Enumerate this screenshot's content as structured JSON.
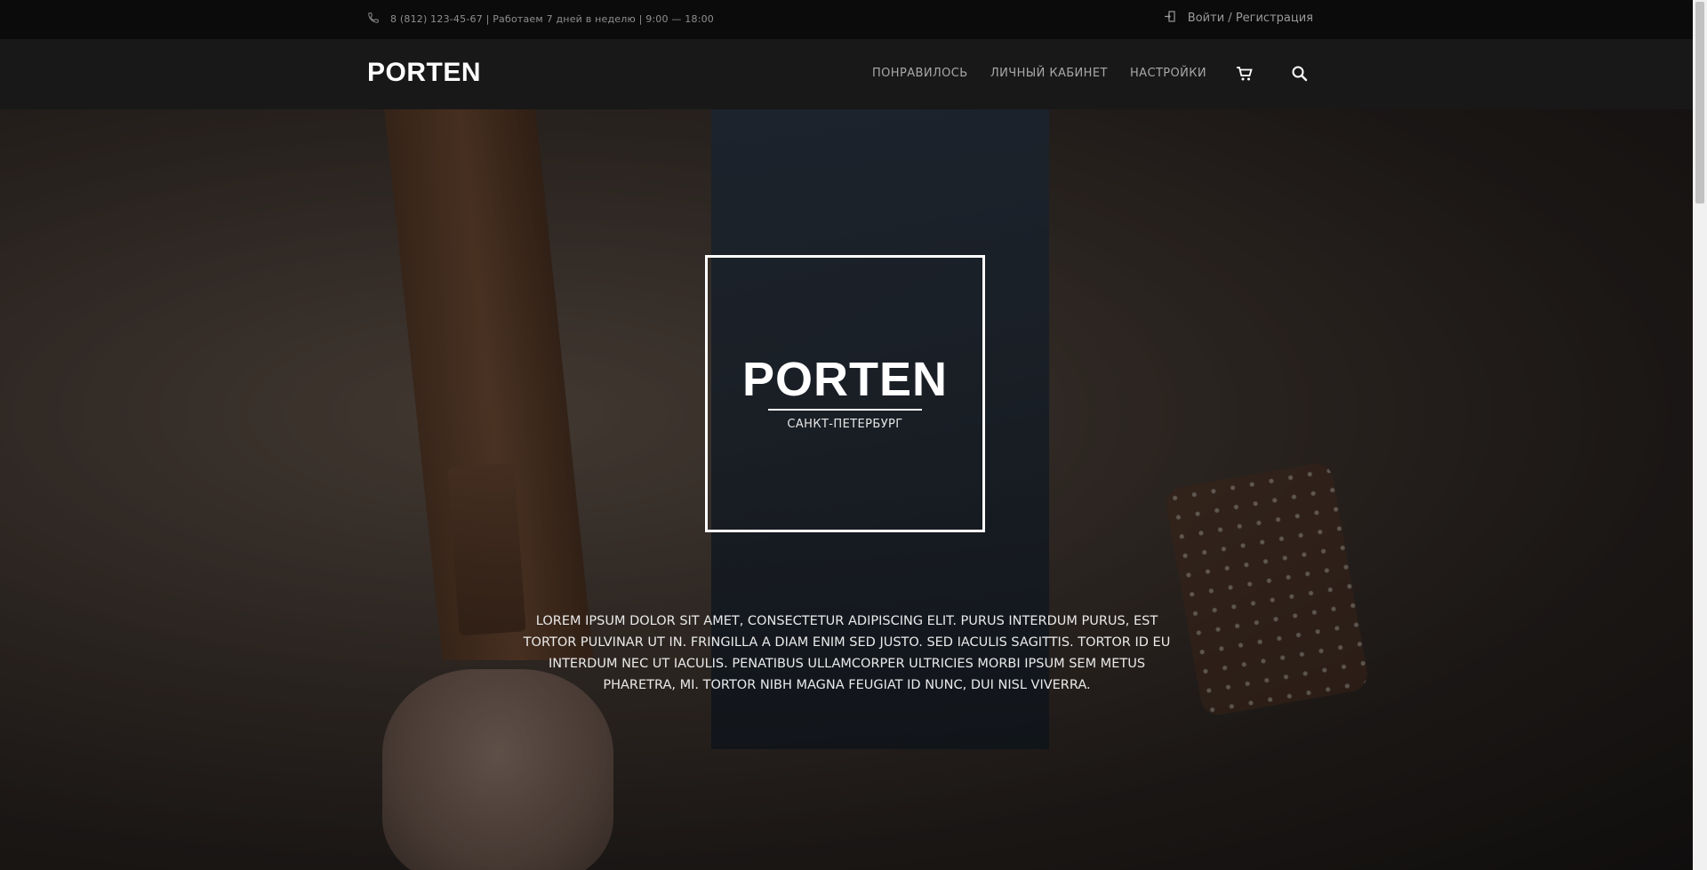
{
  "topbar": {
    "phone_icon": "phone-icon",
    "phone_text": "8 (812) 123-45-67 | Работаем 7 дней в неделю | 9:00 — 18:00",
    "login_icon": "login-icon",
    "login_label": "Войти",
    "separator": "/",
    "register_label": "Регистрация"
  },
  "header": {
    "logo": "PORTEN",
    "nav": [
      {
        "label": "ПОНРАВИЛОСЬ"
      },
      {
        "label": "ЛИЧНЫЙ КАБИНЕТ"
      },
      {
        "label": "НАСТРОЙКИ"
      }
    ],
    "cart_icon": "cart-icon",
    "search_icon": "search-icon"
  },
  "hero": {
    "brand": "PORTEN",
    "city": "САНКТ-ПЕТЕРБУРГ",
    "lead": "LOREM IPSUM DOLOR SIT AMET, CONSECTETUR ADIPISCING ELIT. PURUS INTERDUM PURUS, EST TORTOR PULVINAR UT IN. FRINGILLA A DIAM ENIM SED JUSTO. SED IACULIS SAGITTIS. TORTOR ID EU INTERDUM NEC UT IACULIS. PENATIBUS ULLAMCORPER ULTRICIES MORBI IPSUM SEM METUS PHARETRA, MI. TORTOR NIBH MAGNA FEUGIAT ID NUNC, DUI NISL VIVERRA."
  },
  "colors": {
    "topbar_bg": "#0b0b0b",
    "header_bg": "#181818",
    "text_light": "#ffffff",
    "text_muted": "#9a9a9a"
  }
}
